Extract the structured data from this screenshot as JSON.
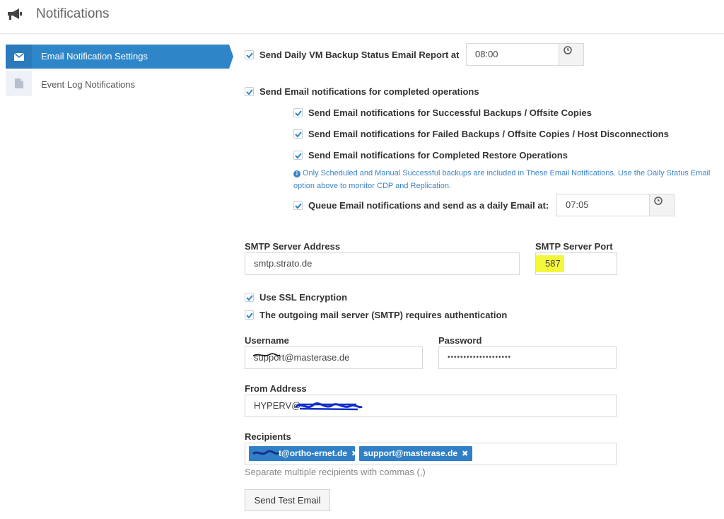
{
  "header": {
    "title": "Notifications",
    "icon": "megaphone-icon"
  },
  "sidebar": {
    "items": [
      {
        "label": "Email Notification Settings",
        "icon": "envelope-icon",
        "active": true
      },
      {
        "label": "Event Log Notifications",
        "icon": "document-icon",
        "active": false
      }
    ]
  },
  "daily_report": {
    "label": "Send Daily VM Backup Status Email Report at",
    "checked": true,
    "time": "08:00"
  },
  "completed_ops": {
    "label": "Send Email notifications for completed operations",
    "checked": true,
    "sub": [
      {
        "label": "Send Email notifications for Successful Backups / Offsite Copies",
        "checked": true
      },
      {
        "label": "Send Email notifications for Failed Backups / Offsite Copies / Host Disconnections",
        "checked": true
      },
      {
        "label": "Send Email notifications for Completed Restore Operations",
        "checked": true
      }
    ],
    "info": "Only Scheduled and Manual Successful backups are included in These Email Notifications. Use the Daily Status Email option above to monitor CDP and Replication.",
    "queue": {
      "label": "Queue Email notifications and send as a daily Email at:",
      "checked": true,
      "time": "07:05"
    }
  },
  "smtp": {
    "server_label": "SMTP Server Address",
    "server_value": "smtp.strato.de",
    "port_label": "SMTP Server Port",
    "port_value": "587",
    "ssl": {
      "label": "Use SSL Encryption",
      "checked": true
    },
    "auth": {
      "label": "The outgoing mail server (SMTP) requires authentication",
      "checked": true
    }
  },
  "credentials": {
    "username_label": "Username",
    "username_value": "support@masterase.de",
    "password_label": "Password",
    "password_value": "••••••••••••••••••••"
  },
  "from": {
    "label": "From Address",
    "value": "HYPERV@"
  },
  "recipients": {
    "label": "Recipients",
    "tags": [
      "t@ortho-ernet.de",
      "support@masterase.de"
    ],
    "help": "Separate multiple recipients with commas (,)"
  },
  "test_button": "Send Test Email",
  "colors": {
    "accent": "#2e86c8",
    "info": "#3d84c6",
    "highlight": "#f4f83d"
  }
}
